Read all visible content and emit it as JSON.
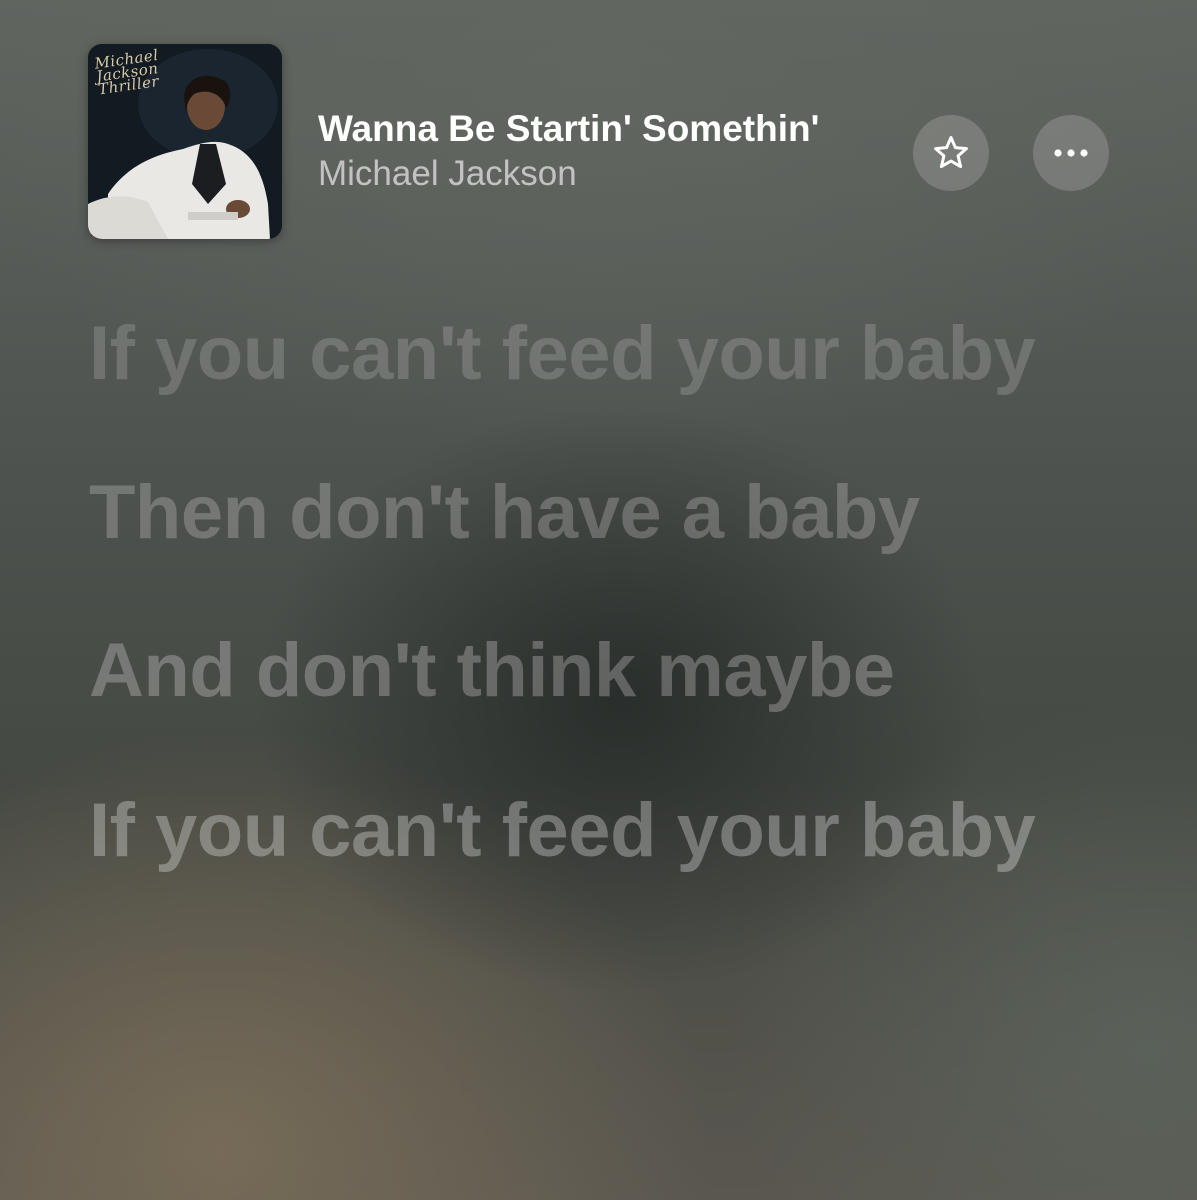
{
  "now_playing": {
    "title": "Wanna Be Startin' Somethin'",
    "artist": "Michael Jackson",
    "artwork": {
      "album_script": "Michael Jackson Thriller",
      "icon": "album-artwork"
    }
  },
  "controls": {
    "favorite_icon": "star-icon",
    "more_icon": "ellipsis-icon"
  },
  "lyrics": [
    "If you can't feed your baby",
    "Then don't have a baby",
    "And don't think maybe",
    "If you can't feed your baby"
  ]
}
